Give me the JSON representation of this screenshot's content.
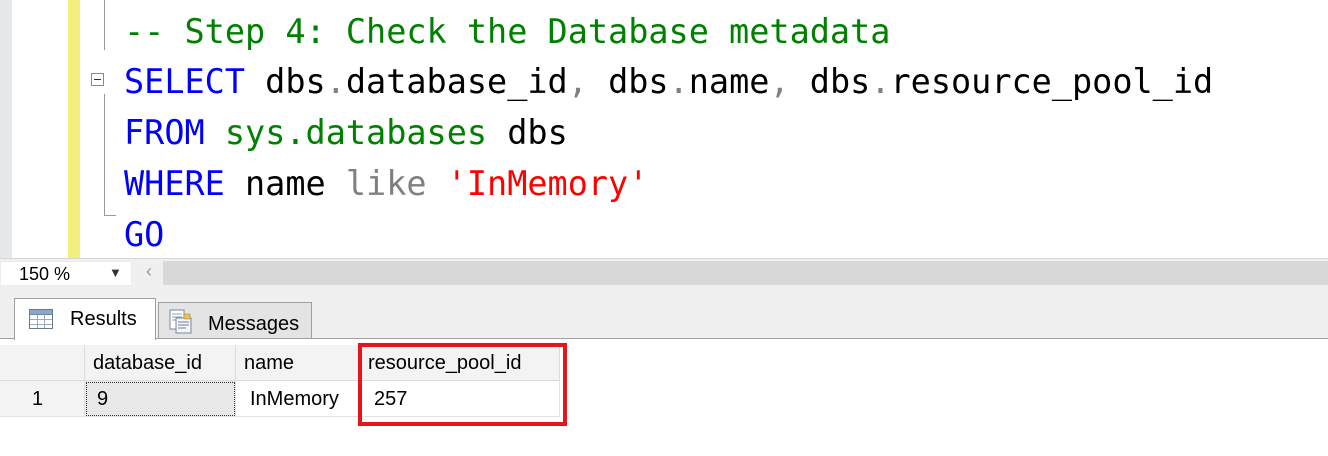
{
  "editor": {
    "lines": [
      {
        "comment": "-- Step 4: Check the Database metadata"
      },
      {
        "kw_select": "SELECT",
        "p1": " dbs",
        "dot1": ".",
        "c1": "database_id",
        "comma1": ",",
        "p2": " dbs",
        "dot2": ".",
        "c2": "name",
        "comma2": ",",
        "p3": " dbs",
        "dot3": ".",
        "c3": "resource_pool_id"
      },
      {
        "kw_from": "FROM",
        "sys": " sys.databases",
        "alias": " dbs"
      },
      {
        "kw_where": "WHERE",
        "col": " name",
        "op": " like",
        "str": " 'InMemory'"
      },
      {
        "kw_go": "GO"
      }
    ]
  },
  "statusbar": {
    "zoom": "150 %",
    "dropdown_icon": "chevron-down-icon",
    "scroll_left_icon": "chevron-left-icon"
  },
  "results": {
    "tabs": [
      {
        "label": "Results",
        "icon": "grid-icon",
        "active": true
      },
      {
        "label": "Messages",
        "icon": "messages-icon",
        "active": false
      }
    ],
    "columns": [
      "database_id",
      "name",
      "resource_pool_id"
    ],
    "rows": [
      {
        "row_number": "1",
        "database_id": "9",
        "name": "InMemory",
        "resource_pool_id": "257"
      }
    ],
    "highlight_color": "#e8141b"
  },
  "colors": {
    "keyword": "#0000ff",
    "comment": "#008000",
    "string": "#ff0000",
    "operator": "#808080",
    "change_bar": "#f3ef7f"
  }
}
